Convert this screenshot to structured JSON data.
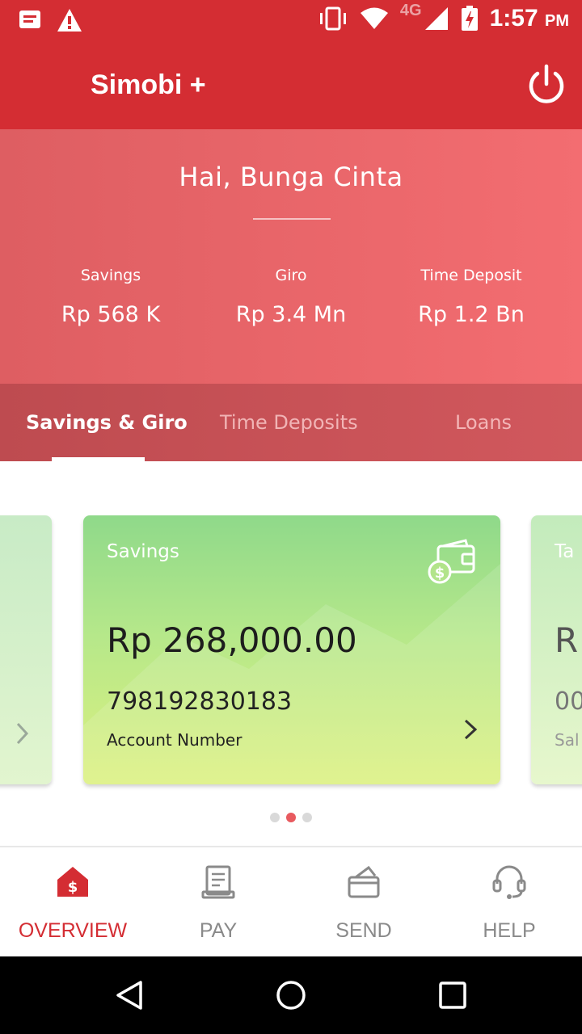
{
  "status_bar": {
    "network": "4G",
    "time": "1:57",
    "ampm": "PM",
    "icons": [
      "notification-icon",
      "warning-icon",
      "vibrate-icon",
      "wifi-icon",
      "signal-icon",
      "battery-charging-icon"
    ]
  },
  "app_bar": {
    "title": "Simobi +",
    "icons": [
      "power-icon"
    ]
  },
  "hero": {
    "greeting": "Hai, Bunga Cinta",
    "balances": [
      {
        "label": "Savings",
        "value": "Rp 568 K"
      },
      {
        "label": "Giro",
        "value": "Rp 3.4 Mn"
      },
      {
        "label": "Time Deposit",
        "value": "Rp 1.2 Bn"
      }
    ]
  },
  "tabs": [
    {
      "label": "Savings & Giro",
      "active": true
    },
    {
      "label": "Time Deposits",
      "active": false
    },
    {
      "label": "Loans",
      "active": false
    }
  ],
  "carousel": {
    "card": {
      "label": "Savings",
      "amount": "Rp 268,000.00",
      "account_number": "798192830183",
      "account_label": "Account Number",
      "icons": [
        "wallet-dollar-icon",
        "chevron-right-icon"
      ]
    },
    "next_card_peek": {
      "label": "Ta",
      "amount": "R",
      "account": "00",
      "sub": "Sal"
    },
    "page_count": 3,
    "active_page": 2
  },
  "bottom_nav": [
    {
      "label": "OVERVIEW",
      "icon": "home-dollar-icon",
      "active": true
    },
    {
      "label": "PAY",
      "icon": "receipt-icon",
      "active": false
    },
    {
      "label": "SEND",
      "icon": "wallet-send-icon",
      "active": false
    },
    {
      "label": "HELP",
      "icon": "headset-icon",
      "active": false
    }
  ],
  "colors": {
    "brand_red": "#d42d33",
    "card_green": "#a8e38a",
    "inactive_gray": "#8a8a8a"
  }
}
